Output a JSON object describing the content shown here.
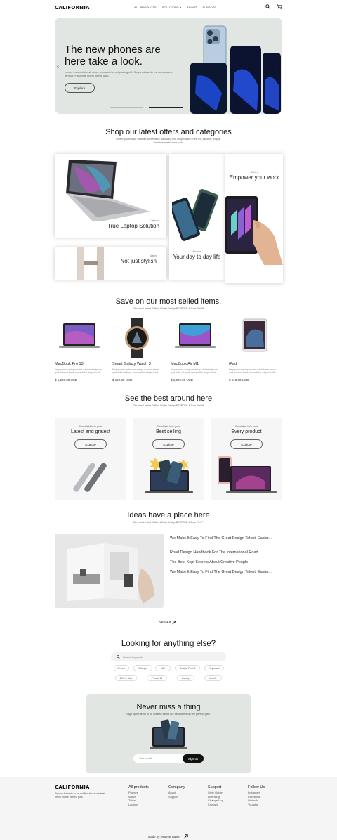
{
  "brand": "CALIFORNIA",
  "nav": {
    "items": [
      "ALL PRODUCTS",
      "SOLUTIONS ▾",
      "ABOUT",
      "SUPPORT"
    ]
  },
  "hero": {
    "title": "The new phones are here take a look.",
    "subtitle": "Lorem ipsum dolor sit amet, consectetur adipiscing elit. Suspendisse in est ac aliquam, tempor. Faucibus morbi lorem justo.",
    "cta": "Explore"
  },
  "offers": {
    "title": "Shop our latest offers and categories",
    "subtitle": "Lorem ipsum dolor sit amet, consectetur adipiscing elit. Suspendisse in est leo, aliquam, tempor. Faucibus morbi lorem justo.",
    "cards": [
      {
        "tag": "Laptops",
        "title": "True Laptop Solution"
      },
      {
        "tag": "Watch",
        "title": "Not just stylish"
      },
      {
        "tag": "Phones",
        "title": "Your day to day life"
      },
      {
        "tag": "Tablet",
        "title": "Empower your work"
      }
    ]
  },
  "selled": {
    "title": "Save on our most selled items.",
    "subtitle": "Our new Limited Edition Winter Design BESPOKE 4-Door Flex™",
    "products": [
      {
        "name": "MacBook Pro 13",
        "desc": "Neque porro quisquam est qui dolorem ipsum quia dolor sit amet, consectetur, adipisci velit",
        "price": "$ 1,200.00 USD"
      },
      {
        "name": "Smart Galaxy Watch 3",
        "desc": "Neque porro quisquam est qui dolorem ipsum quia dolor sit amet, consectetur, adipisci velit",
        "price": "$ 199.00 USD"
      },
      {
        "name": "MacBook Air M1",
        "desc": "Neque porro quisquam est qui dolorem ipsum quia dolor sit amet, consectetur, adipisci velit",
        "price": "$ 1,009.00 USD"
      },
      {
        "name": "iPad",
        "desc": "Neque porro quisquam est qui dolorem ipsum quia dolor sit amet, consectetur, adipisci velit",
        "price": "$ 610.00 USD"
      }
    ]
  },
  "best": {
    "title": "See the best around here",
    "subtitle": "Our new Limited Edition Winter Design BESPOKE 4-Door Flex™",
    "cards": [
      {
        "tag": "Smart light bulb pack",
        "title": "Latest and gratest",
        "cta": "Explore"
      },
      {
        "tag": "Smart light bulb pack",
        "title": "Best selling",
        "cta": "Explore"
      },
      {
        "tag": "Smart light bulb pack",
        "title": "Every product",
        "cta": "Explore"
      }
    ]
  },
  "ideas": {
    "title": "Ideas have a place here",
    "subtitle": "Our new Limited Edition Winter Design BESPOKE 4-Door Flex™",
    "items": [
      "We Make It Easy To Find The Great Design Talent, Easier...",
      "Road Design Handbook For The International Road...",
      "The Best Kept Secrets About Creative People",
      "We Make It Easy To Find The Great Design Talent, Easier..."
    ],
    "see_all": "See All"
  },
  "search": {
    "title": "Looking for anything else?",
    "placeholder": "Search keywords",
    "chips": [
      "iPhone",
      "Charger",
      "Wifi",
      "Google Pixel 3",
      "Keyboard",
      "13 Pro Max",
      "iPhone 12",
      "Laptop",
      "Mobile"
    ]
  },
  "newsletter": {
    "title": "Never miss a thing",
    "subtitle": "Sign up for texts to be notified about our best offers on the perfect gifts.",
    "placeholder": "Your email",
    "cta": "Sign up"
  },
  "footer": {
    "blurb": "Sign up for texts to be notified about our best offers on the perfect gifts.",
    "cols": [
      {
        "title": "All products",
        "links": [
          "Phones",
          "Watch",
          "Tablet",
          "Laptops"
        ]
      },
      {
        "title": "Company",
        "links": [
          "About",
          "Support"
        ]
      },
      {
        "title": "Support",
        "links": [
          "Style Guide",
          "Licensing",
          "Change Log",
          "Contact"
        ]
      },
      {
        "title": "Follow Us",
        "links": [
          "Instagram",
          "Facebook",
          "LinkedIn",
          "Youtube"
        ]
      }
    ],
    "credit": "Made By: Andrew Baker"
  }
}
